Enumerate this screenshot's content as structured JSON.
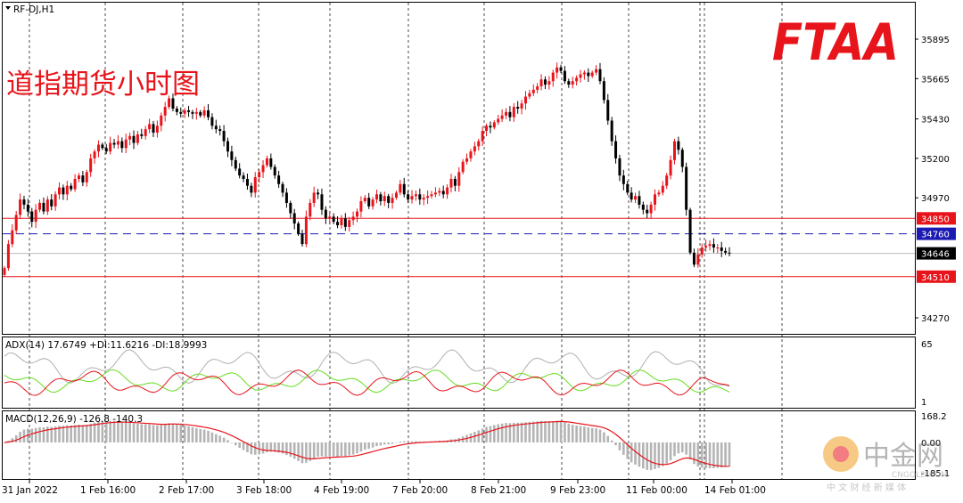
{
  "header": {
    "symbol_label": "RF-DJ,H1"
  },
  "watermark": {
    "logo_text": "FTAA",
    "cn_title": "道指期货小时图",
    "site_logo_cn": "中金网",
    "site_logo_en": "CNGOLD.COM",
    "site_slogan": "中 文 财 经 新 媒 体"
  },
  "colors": {
    "bull": "#e8141b",
    "bear": "#000000",
    "hline_red": "#e8141b",
    "hline_blue": "#1b1bb3",
    "adx": "#b0b0b0",
    "plus_di": "#66dd22",
    "minus_di": "#e8141b",
    "macd_hist": "#b4b4b4",
    "macd_signal": "#e8141b",
    "logo_red": "#e8141b"
  },
  "chart_data": [
    {
      "type": "candlestick",
      "title": "RF-DJ,H1",
      "ylim": [
        34130,
        35980
      ],
      "y_ticks": [
        35895,
        35665,
        35430,
        35200,
        34970,
        34270
      ],
      "x_tick_labels": [
        "31 Jan 2022",
        "1 Feb 16:00",
        "2 Feb 17:00",
        "3 Feb 18:00",
        "4 Feb 19:00",
        "7 Feb 20:00",
        "8 Feb 21:00",
        "9 Feb 23:00",
        "11 Feb 00:00",
        "14 Feb 01:00"
      ],
      "closes": [
        34560,
        34700,
        34780,
        34870,
        34960,
        34930,
        34890,
        34830,
        34900,
        34940,
        34890,
        34960,
        34920,
        34990,
        35030,
        34990,
        35040,
        35020,
        35080,
        35100,
        35060,
        35120,
        35200,
        35240,
        35280,
        35260,
        35240,
        35290,
        35280,
        35300,
        35260,
        35310,
        35330,
        35290,
        35340,
        35330,
        35370,
        35400,
        35350,
        35390,
        35450,
        35500,
        35550,
        35490,
        35470,
        35460,
        35480,
        35470,
        35460,
        35470,
        35450,
        35480,
        35440,
        35390,
        35370,
        35360,
        35300,
        35240,
        35190,
        35140,
        35100,
        35080,
        35040,
        35000,
        35090,
        35120,
        35160,
        35200,
        35150,
        35100,
        35050,
        35000,
        34940,
        34880,
        34820,
        34760,
        34700,
        34860,
        34940,
        35000,
        34990,
        34900,
        34850,
        34860,
        34830,
        34810,
        34850,
        34800,
        34840,
        34860,
        34890,
        34950,
        34970,
        34920,
        34960,
        34990,
        34950,
        34980,
        34940,
        34970,
        35000,
        35050,
        34990,
        34960,
        34980,
        34990,
        34960,
        34970,
        34980,
        34990,
        35000,
        35010,
        34990,
        35030,
        35080,
        35040,
        35120,
        35180,
        35200,
        35240,
        35270,
        35300,
        35360,
        35390,
        35380,
        35410,
        35430,
        35450,
        35470,
        35440,
        35500,
        35490,
        35520,
        35560,
        35580,
        35600,
        35620,
        35660,
        35630,
        35650,
        35700,
        35730,
        35710,
        35650,
        35630,
        35650,
        35670,
        35690,
        35700,
        35680,
        35700,
        35720,
        35650,
        35540,
        35420,
        35300,
        35200,
        35100,
        35050,
        35000,
        34960,
        34980,
        34930,
        34900,
        34880,
        34930,
        34990,
        35000,
        35040,
        35100,
        35190,
        35300,
        35250,
        35150,
        34900,
        34650,
        34580,
        34640,
        34680,
        34690,
        34700,
        34680,
        34680,
        34660,
        34650,
        34646
      ],
      "adx_last": 17.6749,
      "plus_di_last": 11.6216,
      "minus_di_last": 18.9993,
      "macd_last": -126.8,
      "signal_last": -140.3
    },
    {
      "type": "line",
      "title": "ADX(14) 17.6749 +DI:11.6216 -DI:18.9993",
      "ylim": [
        1,
        65
      ]
    },
    {
      "type": "bar",
      "title": "MACD(12,26,9) -126.8 -140.3",
      "ylim": [
        -185.1,
        168.2
      ]
    }
  ],
  "price_axis": {
    "ticks": [
      "35895",
      "35665",
      "35430",
      "35200",
      "34970",
      "34270"
    ],
    "hlines": [
      {
        "label": "34850",
        "value": 34850,
        "kind": "red"
      },
      {
        "label": "34760",
        "value": 34760,
        "kind": "blue"
      },
      {
        "label": "34646",
        "value": 34646,
        "kind": "current"
      },
      {
        "label": "34510",
        "value": 34510,
        "kind": "red"
      }
    ]
  },
  "adx_panel": {
    "title": "ADX(14) 17.6749 +DI:11.6216 -DI:18.9993",
    "ticks": [
      "65",
      "1"
    ],
    "ylim": [
      1,
      65
    ]
  },
  "macd_panel": {
    "title": "MACD(12,26,9) -126.8 -140.3",
    "ticks": [
      "168.2",
      "0.00",
      "-185.1"
    ],
    "ylim": [
      -185.1,
      168.2
    ]
  },
  "time_axis": {
    "labels": [
      "31 Jan 2022",
      "1 Feb 16:00",
      "2 Feb 17:00",
      "3 Feb 18:00",
      "4 Feb 19:00",
      "7 Feb 20:00",
      "8 Feb 21:00",
      "9 Feb 23:00",
      "11 Feb 00:00",
      "14 Feb 01:00"
    ]
  }
}
